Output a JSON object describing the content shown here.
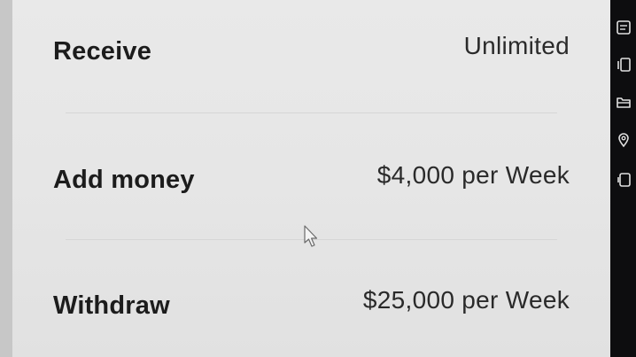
{
  "limits": {
    "rows": [
      {
        "label": "Receive",
        "value": "Unlimited"
      },
      {
        "label": "Add money",
        "value": "$4,000 per Week"
      },
      {
        "label": "Withdraw",
        "value": "$25,000 per Week"
      }
    ]
  },
  "sidebar": {
    "icons": [
      "document-icon",
      "copy-icon",
      "folder-icon",
      "location-pin-icon",
      "tablet-icon"
    ]
  },
  "colors": {
    "panel_bg": "#e8e8e8",
    "sidebar_bg": "#0d0d0f",
    "text_primary": "#1c1c1c",
    "divider": "#d6d6d6"
  }
}
